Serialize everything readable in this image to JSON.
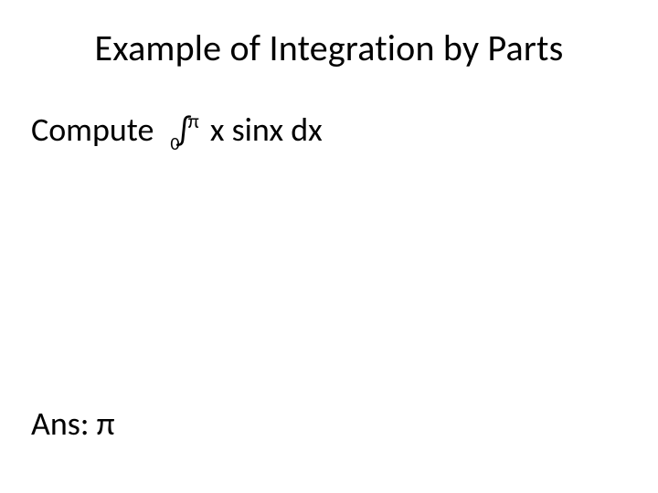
{
  "slide": {
    "title": "Example of Integration by Parts",
    "problem": {
      "label": "Compute",
      "lower_limit": "0",
      "integral_symbol": "∫",
      "upper_limit": "π",
      "integrand": "x sinx dx"
    },
    "answer": {
      "label": "Ans:",
      "value": "π"
    }
  }
}
